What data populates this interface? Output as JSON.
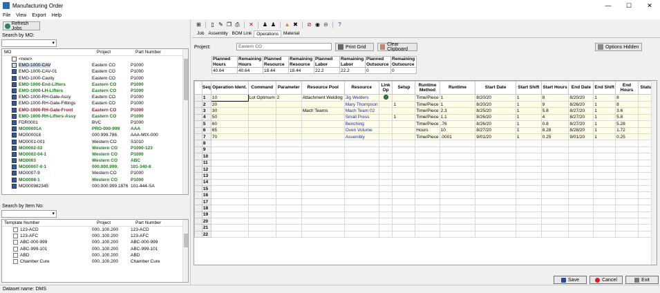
{
  "window": {
    "title": "Manufacturing Order",
    "minimize": "—",
    "maximize": "☐",
    "close": "✕"
  },
  "menu": [
    "File",
    "View",
    "Export",
    "Help"
  ],
  "left": {
    "refresh_label": "Refresh Jobs",
    "search_mo_label": "Search by MO:",
    "search_mo_value": "",
    "mo_headers": [
      "MO",
      "Project",
      "Part Number"
    ],
    "mo_rows": [
      {
        "mo": "<new>",
        "project": "",
        "part": "",
        "style": "new"
      },
      {
        "mo": "EMO-1000-CAV",
        "project": "Eastern CO",
        "part": "P1000",
        "style": "sel"
      },
      {
        "mo": "EMO-1000-CAV-01",
        "project": "Eastern CO",
        "part": "P1000",
        "style": ""
      },
      {
        "mo": "EMO-1000-Cavity",
        "project": "Eastern CO",
        "part": "P1000",
        "style": ""
      },
      {
        "mo": "EMO-1000-End-Lifters",
        "project": "Eastern CO",
        "part": "P1000",
        "style": "green"
      },
      {
        "mo": "EMO-1000-LH-Lifters",
        "project": "Eastern CO",
        "part": "P1000",
        "style": "green"
      },
      {
        "mo": "EMO-1000-RH-Gate-Assy",
        "project": "Eastern CO",
        "part": "P1000",
        "style": ""
      },
      {
        "mo": "EMO-1000-RH-Gate-Fittings",
        "project": "Eastern CO",
        "part": "P1000",
        "style": ""
      },
      {
        "mo": "EMO-1000-RH-Gate-Front",
        "project": "Eastern CO",
        "part": "P1000",
        "style": "red"
      },
      {
        "mo": "EMO-1000-RH-Lifters-Assy",
        "project": "Eastern CO",
        "part": "P1000",
        "style": "green"
      },
      {
        "mo": "FDR0001",
        "project": "BVC",
        "part": "P1000",
        "style": ""
      },
      {
        "mo": "MO00001A",
        "project": "PRO-000-999",
        "part": "AAA",
        "style": "green"
      },
      {
        "mo": "MO000018",
        "project": "000.999.786.",
        "part": "AAA-MIX-000",
        "style": ""
      },
      {
        "mo": "MO0001-001",
        "project": "Western CO",
        "part": "S1010",
        "style": ""
      },
      {
        "mo": "MO0002-02",
        "project": "Western CO",
        "part": "P1000-123",
        "style": "green"
      },
      {
        "mo": "MO0002-04-1",
        "project": "Western CO",
        "part": "P1000",
        "style": "green"
      },
      {
        "mo": "MO0003",
        "project": "Western CO",
        "part": "ABC",
        "style": "green"
      },
      {
        "mo": "MO00007-0-1",
        "project": "000.000.999.",
        "part": "101-340-8",
        "style": "green"
      },
      {
        "mo": "MO0007-9",
        "project": "Western CO",
        "part": "P1000",
        "style": ""
      },
      {
        "mo": "MO0008-1",
        "project": "Western CO",
        "part": "P1000",
        "style": "green"
      },
      {
        "mo": "MO000982345",
        "project": "000.000.999.1876",
        "part": "101-444-SA",
        "style": ""
      }
    ],
    "search_item_label": "Search by Item No:",
    "search_item_value": "",
    "tpl_headers": [
      "Template Number",
      "Project",
      "Part Number"
    ],
    "tpl_rows": [
      {
        "tpl": "123-ACD",
        "project": "000..100.200",
        "part": "123-ACD"
      },
      {
        "tpl": "123-AFC",
        "project": "000..100.200",
        "part": "123-AFC"
      },
      {
        "tpl": "ABC-000-999",
        "project": "000..100.200",
        "part": "ABC-000-999"
      },
      {
        "tpl": "ABC-999-101",
        "project": "000..100.200",
        "part": "ABC-999-101"
      },
      {
        "tpl": "ABD",
        "project": "000..100.200",
        "part": "ABD"
      },
      {
        "tpl": "Chamber Cure",
        "project": "000..100.200",
        "part": "Chamber Cure"
      }
    ]
  },
  "tabs": [
    "Job",
    "Assembly",
    "BOM Link",
    "Operations",
    "Material"
  ],
  "active_tab": "Operations",
  "project_label": "Project:",
  "project_value": "Eastern CO",
  "print_grid_label": "Print Grid",
  "clear_clipboard_label": "Clear Clipboard",
  "options_hidden_label": "Options Hidden",
  "summary": {
    "headers": [
      "Planned Hours",
      "Remaining Hours",
      "Planned Resource",
      "Remaining Resource",
      "Planned Labor",
      "Remaining Labor",
      "Planned Outsource",
      "Remaining Outsource"
    ],
    "values": [
      "40.64",
      "40.64",
      "18.44",
      "18.44",
      "22.2",
      "22.2",
      "0",
      "0"
    ]
  },
  "grid": {
    "headers": [
      "Seq",
      "Operation Ident.",
      "Command",
      "Parameter",
      "Resource Pool",
      "Resource",
      "Link Op",
      "Setup",
      "Runtime Method",
      "Runtime",
      "Start Date",
      "Start Shift",
      "Start Hours",
      "End Date",
      "End Shift",
      "End Hours",
      "Status"
    ],
    "rows": [
      [
        "1",
        "10",
        "Lot Optimum",
        "2",
        "Attachment Welding",
        "Jig Welders",
        "●",
        "",
        "Time/Piece",
        "1",
        "8/20/20",
        "1",
        "8",
        "8/20/20",
        "1",
        "8",
        ""
      ],
      [
        "2",
        "20",
        "",
        "",
        "",
        "Mary Thompson",
        "",
        "1",
        "Time/Piece",
        "1",
        "8/20/20",
        "1",
        "9",
        "8/26/20",
        "1",
        "8",
        ""
      ],
      [
        "3",
        "30",
        "",
        "",
        "Mach Teams",
        "Mach Team 02",
        "",
        "",
        "Time/Piece",
        "2.3",
        "8/25/20",
        "1",
        "5.8",
        "8/27/20",
        "1",
        "3.6",
        ""
      ],
      [
        "4",
        "50",
        "",
        "",
        "",
        "Small Press",
        "",
        "1",
        "Time/Piece",
        "1.1",
        "8/26/20",
        "1",
        "4",
        "8/27/20",
        "1",
        "5.8",
        ""
      ],
      [
        "5",
        "60",
        "",
        "",
        "",
        "Benching",
        "",
        "",
        "Time/Piece",
        ".76",
        "8/26/20",
        "1",
        "0.8",
        "8/27/20",
        "1",
        "5.28",
        ""
      ],
      [
        "6",
        "65",
        "",
        "",
        "",
        "Oven Volume",
        "",
        "",
        "Hours",
        "10",
        "8/27/20",
        "1",
        "8.28",
        "8/28/20",
        "1",
        "1.72",
        ""
      ],
      [
        "7",
        "70",
        "",
        "",
        "",
        "Assembly",
        "",
        "",
        "Time/Piece",
        ".0001",
        "9/01/20",
        "1",
        "0.25",
        "9/01/20",
        "1",
        "0.25",
        ""
      ]
    ],
    "empty_rows": [
      "8",
      "9",
      "10",
      "11",
      "12",
      "13",
      "14",
      "15",
      "16",
      "17",
      "18",
      "19",
      "20",
      "21",
      "22"
    ]
  },
  "footer": {
    "save": "Save",
    "cancel": "Cancel",
    "exit": "Exit",
    "dataset_label": "Dataset name:",
    "dataset_value": "DMS"
  },
  "colors": {
    "green": "#1a7a1a",
    "red": "#8b1a1a",
    "grid_row": "#fffde8",
    "link_blue": "#1a2a9a"
  }
}
